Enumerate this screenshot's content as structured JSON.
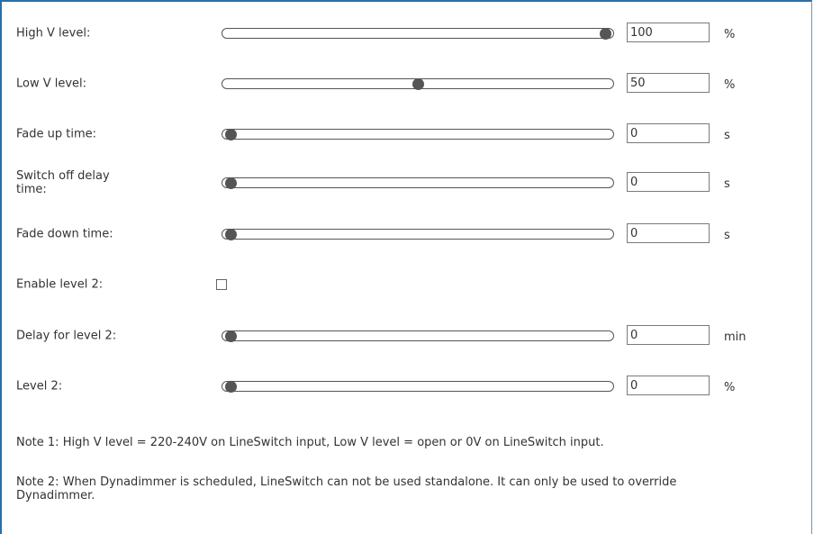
{
  "rows": [
    {
      "label": "High V level:",
      "value": "100",
      "unit": "%",
      "level": 1.0
    },
    {
      "label": "Low V level:",
      "value": "50",
      "unit": "%",
      "level": 0.5
    },
    {
      "label": "Fade up time:",
      "value": "0",
      "unit": "s",
      "level": 0
    },
    {
      "label": "Switch off delay time:",
      "value": "0",
      "unit": "s",
      "level": 0
    },
    {
      "label": "Fade down time:",
      "value": "0",
      "unit": "s",
      "level": 0
    }
  ],
  "enable_level2": {
    "label": "Enable level 2:",
    "checked": false
  },
  "rows2": [
    {
      "label": "Delay for level 2:",
      "value": "0",
      "unit": "min",
      "level": 0
    },
    {
      "label": "Level 2:",
      "value": "0",
      "unit": "%",
      "level": 0
    }
  ],
  "notes": {
    "note1": "Note 1: High V level = 220-240V on LineSwitch input, Low V level = open or 0V on LineSwitch input.",
    "note2": "Note 2: When Dynadimmer is scheduled, LineSwitch can not be used standalone. It can only be used to override Dynadimmer."
  }
}
